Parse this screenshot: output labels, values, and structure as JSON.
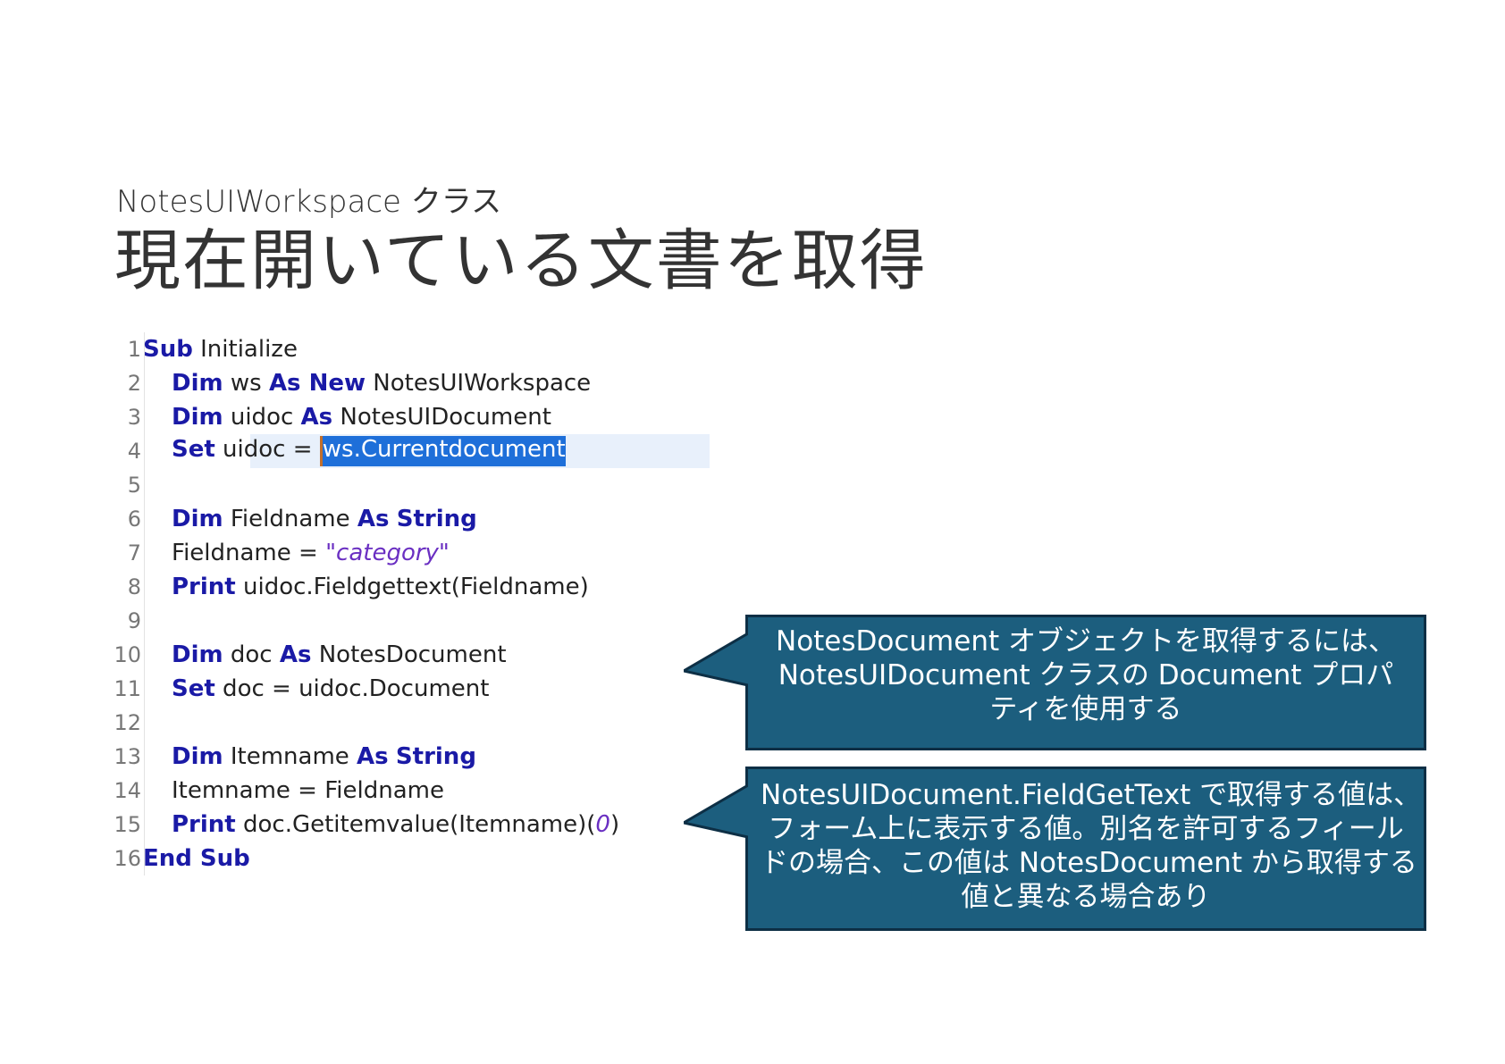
{
  "header": {
    "subtitle": "NotesUIWorkspace クラス",
    "title": "現在開いている文書を取得"
  },
  "code": {
    "lines": [
      {
        "no": "1"
      },
      {
        "no": "2"
      },
      {
        "no": "3"
      },
      {
        "no": "4"
      },
      {
        "no": "5"
      },
      {
        "no": "6"
      },
      {
        "no": "7"
      },
      {
        "no": "8"
      },
      {
        "no": "9"
      },
      {
        "no": "10"
      },
      {
        "no": "11"
      },
      {
        "no": "12"
      },
      {
        "no": "13"
      },
      {
        "no": "14"
      },
      {
        "no": "15"
      },
      {
        "no": "16"
      }
    ],
    "tokens": {
      "sub": "Sub",
      "initialize": " Initialize",
      "dim": "Dim",
      "ws": " ws ",
      "as": "As",
      "new": " New",
      "notesuiworkspace": " NotesUIWorkspace",
      "uidoc": " uidoc ",
      "notesuidocument": " NotesUIDocument",
      "set": "Set",
      "uidoc_eq": " uidoc = ",
      "selected": "ws.Currentdocument",
      "fieldname": " Fieldname ",
      "string": "String",
      "fieldname_assign": "Fieldname = ",
      "category": "\"category\"",
      "print": "Print",
      "fieldgettext": " uidoc.Fieldgettext(Fieldname)",
      "doc": " doc ",
      "notesdocument": " NotesDocument",
      "doc_eq": " doc = uidoc.Document",
      "itemname": " Itemname ",
      "itemname_assign": "Itemname = Fieldname",
      "getitemvalue": " doc.Getitemvalue(Itemname)(",
      "zero": "0",
      "close_paren": ")",
      "end_sub": "End Sub"
    }
  },
  "callouts": [
    {
      "lines": [
        "NotesDocument オブジェクトを取得するには、",
        "NotesUIDocument クラスの Document プロパ",
        "ティを使用する"
      ]
    },
    {
      "lines": [
        "NotesUIDocument.FieldGetText で取得する値は、",
        "フォーム上に表示する値。別名を許可するフィール",
        "ドの場合、この値は NotesDocument から取得する",
        "値と異なる場合あり"
      ]
    }
  ],
  "colors": {
    "callout_fill": "#1c5e7e",
    "callout_border": "#0d2f45",
    "keyword": "#1a1aa6",
    "string": "#6a2fc2",
    "selection": "#1e6fd9"
  }
}
